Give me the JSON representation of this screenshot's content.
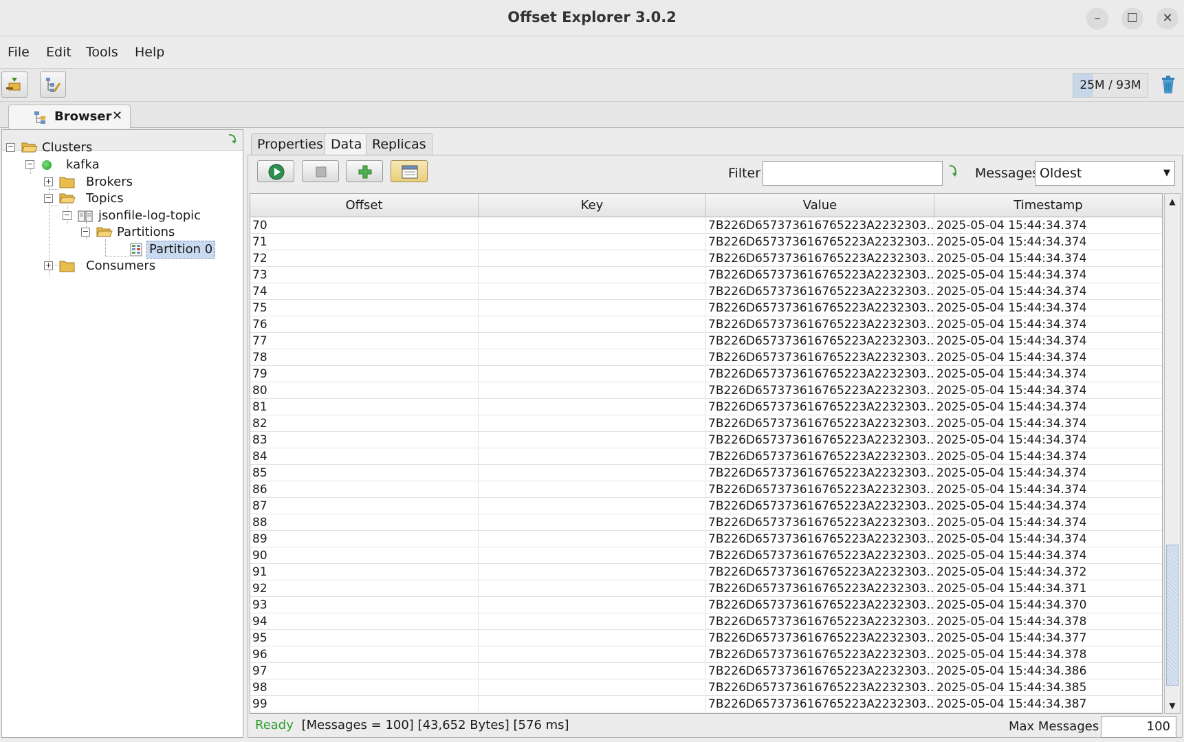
{
  "window": {
    "title": "Offset Explorer  3.0.2"
  },
  "menu": {
    "file": "File",
    "edit": "Edit",
    "tools": "Tools",
    "help": "Help"
  },
  "toolbar": {
    "memory": "25M / 93M",
    "memory_used_fraction": 0.27
  },
  "doc_tab": {
    "label": "Browser",
    "close": "✕"
  },
  "tree": {
    "clusters": "Clusters",
    "kafka": "kafka",
    "brokers": "Brokers",
    "topics": "Topics",
    "topic": "jsonfile-log-topic",
    "partitions": "Partitions",
    "partition0": "Partition 0",
    "consumers": "Consumers"
  },
  "subtabs": {
    "properties": "Properties",
    "data": "Data",
    "replicas": "Replicas"
  },
  "filter": {
    "label": "Filter",
    "value": ""
  },
  "messages": {
    "label": "Messages",
    "selected": "Oldest"
  },
  "table": {
    "columns": [
      "Offset",
      "Key",
      "Value",
      "Timestamp"
    ],
    "rows": [
      [
        "70",
        "",
        "7B226D657373616765223A2232303...",
        "2025-05-04 15:44:34.374"
      ],
      [
        "71",
        "",
        "7B226D657373616765223A2232303...",
        "2025-05-04 15:44:34.374"
      ],
      [
        "72",
        "",
        "7B226D657373616765223A2232303...",
        "2025-05-04 15:44:34.374"
      ],
      [
        "73",
        "",
        "7B226D657373616765223A2232303...",
        "2025-05-04 15:44:34.374"
      ],
      [
        "74",
        "",
        "7B226D657373616765223A2232303...",
        "2025-05-04 15:44:34.374"
      ],
      [
        "75",
        "",
        "7B226D657373616765223A2232303...",
        "2025-05-04 15:44:34.374"
      ],
      [
        "76",
        "",
        "7B226D657373616765223A2232303...",
        "2025-05-04 15:44:34.374"
      ],
      [
        "77",
        "",
        "7B226D657373616765223A2232303...",
        "2025-05-04 15:44:34.374"
      ],
      [
        "78",
        "",
        "7B226D657373616765223A2232303...",
        "2025-05-04 15:44:34.374"
      ],
      [
        "79",
        "",
        "7B226D657373616765223A2232303...",
        "2025-05-04 15:44:34.374"
      ],
      [
        "80",
        "",
        "7B226D657373616765223A2232303...",
        "2025-05-04 15:44:34.374"
      ],
      [
        "81",
        "",
        "7B226D657373616765223A2232303...",
        "2025-05-04 15:44:34.374"
      ],
      [
        "82",
        "",
        "7B226D657373616765223A2232303...",
        "2025-05-04 15:44:34.374"
      ],
      [
        "83",
        "",
        "7B226D657373616765223A2232303...",
        "2025-05-04 15:44:34.374"
      ],
      [
        "84",
        "",
        "7B226D657373616765223A2232303...",
        "2025-05-04 15:44:34.374"
      ],
      [
        "85",
        "",
        "7B226D657373616765223A2232303...",
        "2025-05-04 15:44:34.374"
      ],
      [
        "86",
        "",
        "7B226D657373616765223A2232303...",
        "2025-05-04 15:44:34.374"
      ],
      [
        "87",
        "",
        "7B226D657373616765223A2232303...",
        "2025-05-04 15:44:34.374"
      ],
      [
        "88",
        "",
        "7B226D657373616765223A2232303...",
        "2025-05-04 15:44:34.374"
      ],
      [
        "89",
        "",
        "7B226D657373616765223A2232303...",
        "2025-05-04 15:44:34.374"
      ],
      [
        "90",
        "",
        "7B226D657373616765223A2232303...",
        "2025-05-04 15:44:34.374"
      ],
      [
        "91",
        "",
        "7B226D657373616765223A2232303...",
        "2025-05-04 15:44:34.372"
      ],
      [
        "92",
        "",
        "7B226D657373616765223A2232303...",
        "2025-05-04 15:44:34.371"
      ],
      [
        "93",
        "",
        "7B226D657373616765223A2232303...",
        "2025-05-04 15:44:34.370"
      ],
      [
        "94",
        "",
        "7B226D657373616765223A2232303...",
        "2025-05-04 15:44:34.378"
      ],
      [
        "95",
        "",
        "7B226D657373616765223A2232303...",
        "2025-05-04 15:44:34.377"
      ],
      [
        "96",
        "",
        "7B226D657373616765223A2232303...",
        "2025-05-04 15:44:34.378"
      ],
      [
        "97",
        "",
        "7B226D657373616765223A2232303...",
        "2025-05-04 15:44:34.386"
      ],
      [
        "98",
        "",
        "7B226D657373616765223A2232303...",
        "2025-05-04 15:44:34.385"
      ],
      [
        "99",
        "",
        "7B226D657373616765223A2232303...",
        "2025-05-04 15:44:34.387"
      ]
    ]
  },
  "status": {
    "ready": "Ready",
    "details": "[Messages = 100]  [43,652 Bytes]  [576 ms]"
  },
  "max_messages": {
    "label": "Max Messages",
    "value": "100"
  },
  "colors": {
    "selection": "#c9d9ef",
    "ready": "#2e9e2e",
    "toggled_button": "#e9cf7b"
  }
}
